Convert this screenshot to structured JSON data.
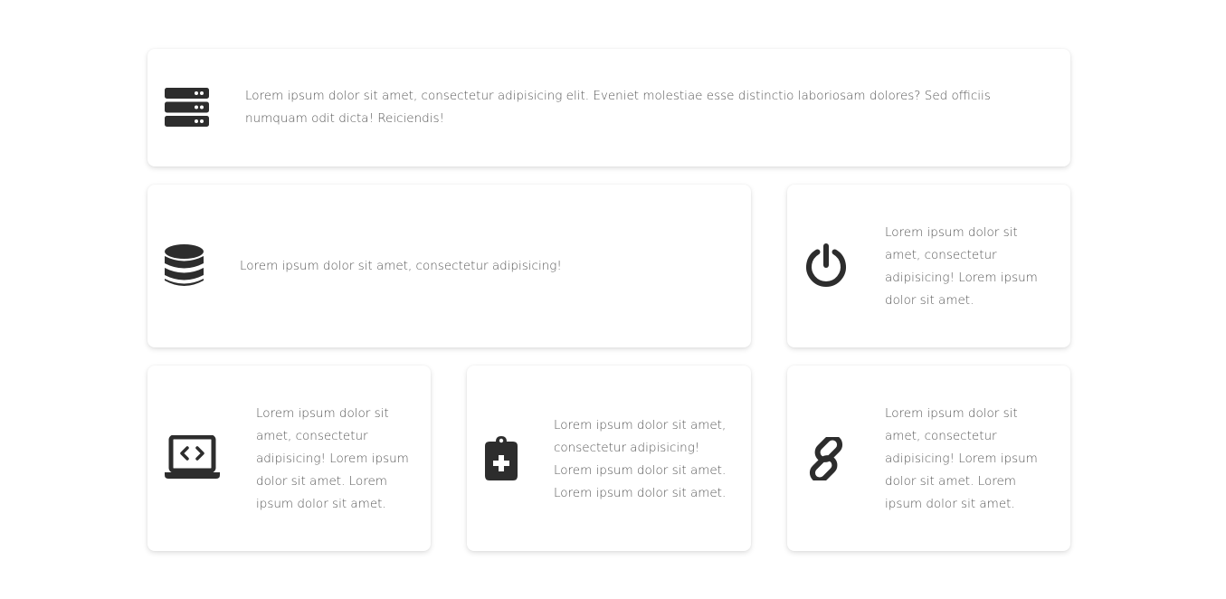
{
  "colors": {
    "icon": "#2d2d2d",
    "text": "#555555",
    "card_background": "#ffffff",
    "page_background": "#ffffff"
  },
  "cards": [
    {
      "icon": "server-icon",
      "text": "Lorem ipsum dolor sit amet, consectetur adipisicing elit. Eveniet molestiae esse distinctio laboriosam dolores? Sed officiis numquam odit dicta! Reiciendis!"
    },
    {
      "icon": "database-icon",
      "text": "Lorem ipsum dolor sit amet, consectetur adipisicing!"
    },
    {
      "icon": "power-icon",
      "text": "Lorem ipsum dolor sit amet, consectetur adipisicing! Lorem ipsum dolor sit amet."
    },
    {
      "icon": "laptop-code-icon",
      "text": "Lorem ipsum dolor sit amet, consectetur adipisicing! Lorem ipsum dolor sit amet. Lorem ipsum dolor sit amet."
    },
    {
      "icon": "clipboard-medical-icon",
      "text": "Lorem ipsum dolor sit amet, consectetur adipisicing! Lorem ipsum dolor sit amet. Lorem ipsum dolor sit amet."
    },
    {
      "icon": "link-icon",
      "text": "Lorem ipsum dolor sit amet, consectetur adipisicing! Lorem ipsum dolor sit amet. Lorem ipsum dolor sit amet."
    }
  ]
}
